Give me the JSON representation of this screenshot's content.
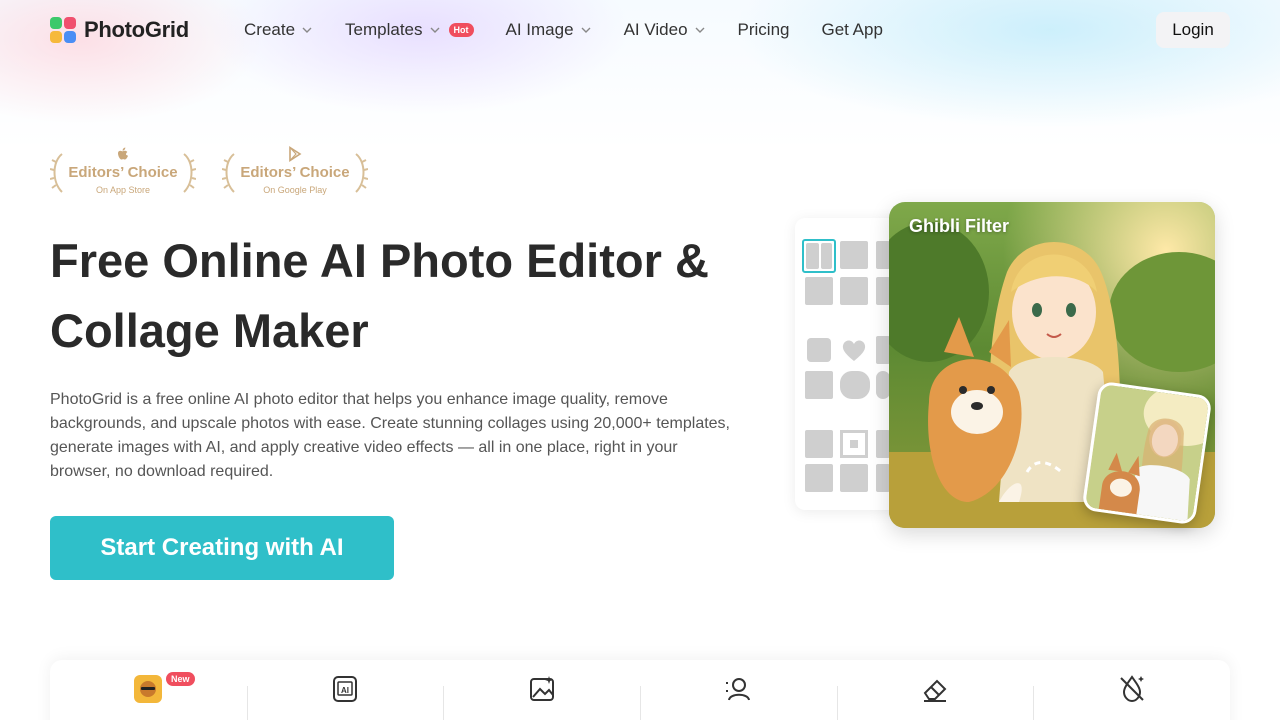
{
  "brand": {
    "name": "PhotoGrid"
  },
  "nav": {
    "items": [
      {
        "label": "Create",
        "dropdown": true
      },
      {
        "label": "Templates",
        "dropdown": true,
        "badge": "Hot"
      },
      {
        "label": "AI Image",
        "dropdown": true
      },
      {
        "label": "AI Video",
        "dropdown": true
      },
      {
        "label": "Pricing",
        "dropdown": false
      },
      {
        "label": "Get App",
        "dropdown": false
      }
    ],
    "login_label": "Login"
  },
  "awards": [
    {
      "title": "Editors’ Choice",
      "subtitle": "On App Store",
      "icon": "apple-icon"
    },
    {
      "title": "Editors’ Choice",
      "subtitle": "On Google Play",
      "icon": "google-play-icon"
    }
  ],
  "hero": {
    "title_line1": "Free Online AI Photo Editor &",
    "title_line2": "Collage Maker",
    "description": "PhotoGrid is a free online AI photo editor that helps you enhance image quality, remove backgrounds, and upscale photos with ease. Create stunning collages using 20,000+ templates, generate images with AI, and apply creative video effects — all in one place, right in your browser, no download required.",
    "cta_label": "Start Creating with AI"
  },
  "showcase": {
    "filter_label": "Ghibli Filter"
  },
  "tools": [
    {
      "icon": "ai-avatar-icon",
      "badge": "New"
    },
    {
      "icon": "ai-text-icon"
    },
    {
      "icon": "image-enhance-icon"
    },
    {
      "icon": "portrait-icon"
    },
    {
      "icon": "eraser-icon"
    },
    {
      "icon": "remove-object-icon"
    }
  ],
  "colors": {
    "accent": "#2fbfc9",
    "hot_badge": "#f04e5e",
    "award_gold": "#c9a77a"
  }
}
